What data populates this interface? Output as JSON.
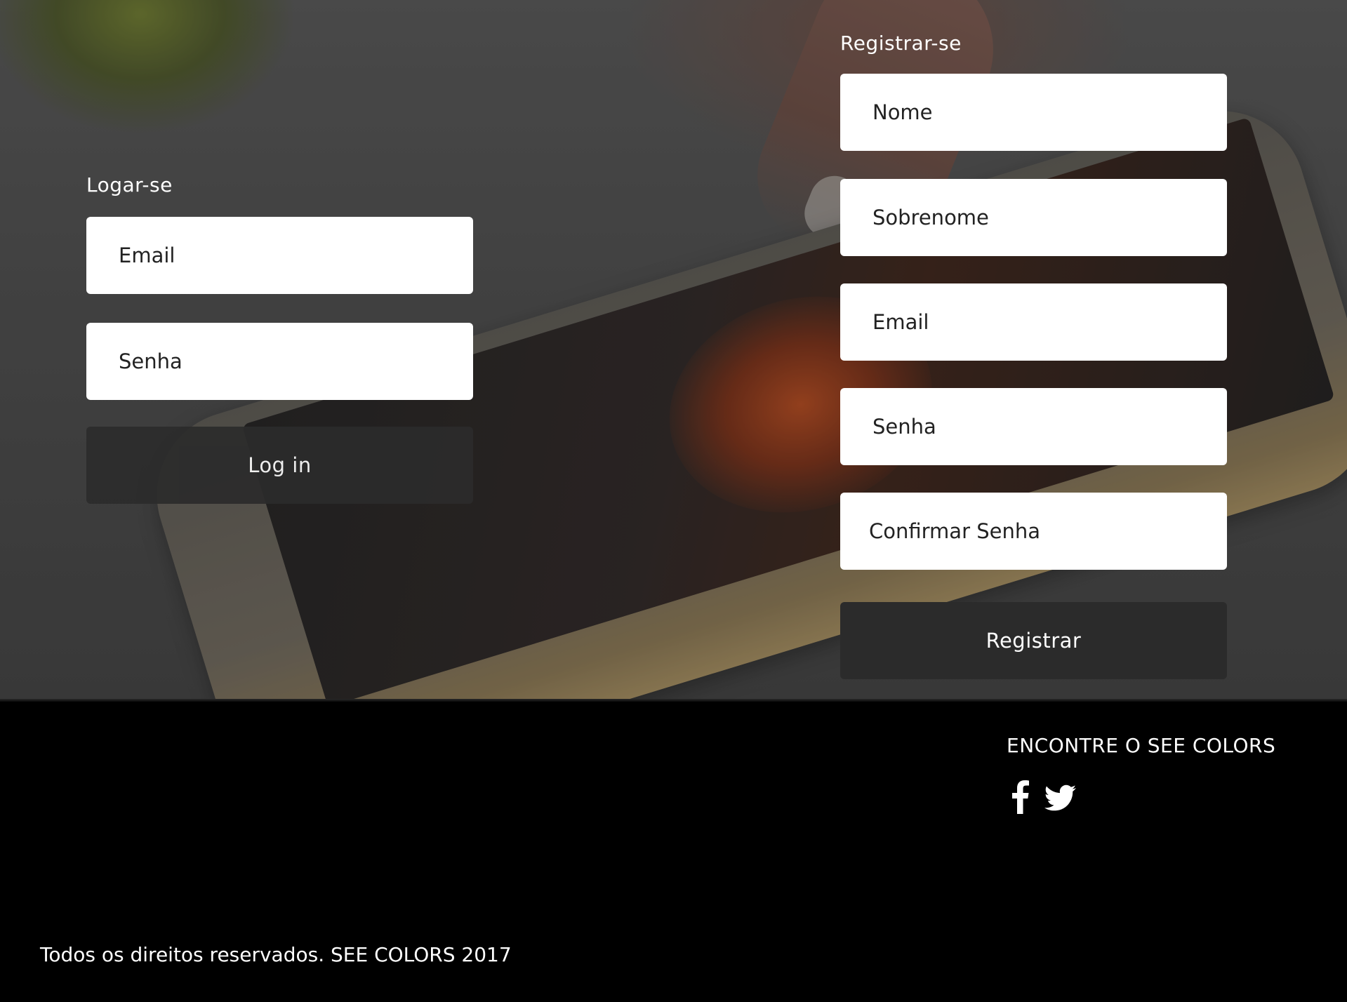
{
  "login": {
    "title": "Logar-se",
    "email_placeholder": "Email",
    "password_placeholder": "Senha",
    "button_label": "Log in"
  },
  "register": {
    "title": "Registrar-se",
    "name_placeholder": "Nome",
    "surname_placeholder": "Sobrenome",
    "email_placeholder": "Email",
    "password_placeholder": "Senha",
    "confirm_password_placeholder": "Confirmar Senha",
    "button_label": "Registrar"
  },
  "footer": {
    "social_title": "ENCONTRE O SEE COLORS",
    "social_icons": [
      "facebook-icon",
      "twitter-icon"
    ],
    "copyright": "Todos os direitos reservados. SEE COLORS 2017"
  },
  "colors": {
    "button_bg": "#2b2b2b",
    "footer_bg": "#000000",
    "field_bg": "#ffffff"
  }
}
